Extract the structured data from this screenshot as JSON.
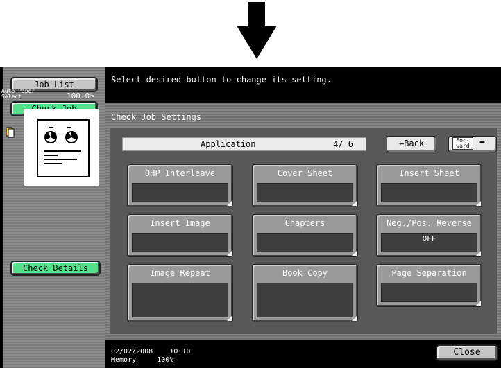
{
  "sidebar": {
    "job_list": "Job List",
    "check_job": "Check Job",
    "paper_label_1": "Auto Paper",
    "paper_label_2": "Select",
    "zoom": "100.0%",
    "check_details": "Check Details"
  },
  "header": {
    "message": "Select desired button to change its setting."
  },
  "panel": {
    "title": "Check Job Settings",
    "tab": "Application",
    "page": "4/ 6",
    "back": "←Back",
    "forward_1": "For-",
    "forward_2": "ward",
    "forward_arrow": "➡"
  },
  "functions": [
    {
      "label": "OHP Interleave",
      "value": ""
    },
    {
      "label": "Cover Sheet",
      "value": ""
    },
    {
      "label": "Insert Sheet",
      "value": ""
    },
    {
      "label": "Insert Image",
      "value": ""
    },
    {
      "label": "Chapters",
      "value": ""
    },
    {
      "label": "Neg./Pos. Reverse",
      "value": "OFF"
    },
    {
      "label": "Image Repeat",
      "value": ""
    },
    {
      "label": "Book Copy",
      "value": ""
    },
    {
      "label": "Page Separation",
      "value": ""
    }
  ],
  "status": {
    "date": "02/02/2008",
    "time": "10:10",
    "memory_label": "Memory",
    "memory_value": "100%"
  },
  "close": "Close",
  "colors": {
    "check_job_green": "#52e08a",
    "screen_black": "#000000"
  }
}
